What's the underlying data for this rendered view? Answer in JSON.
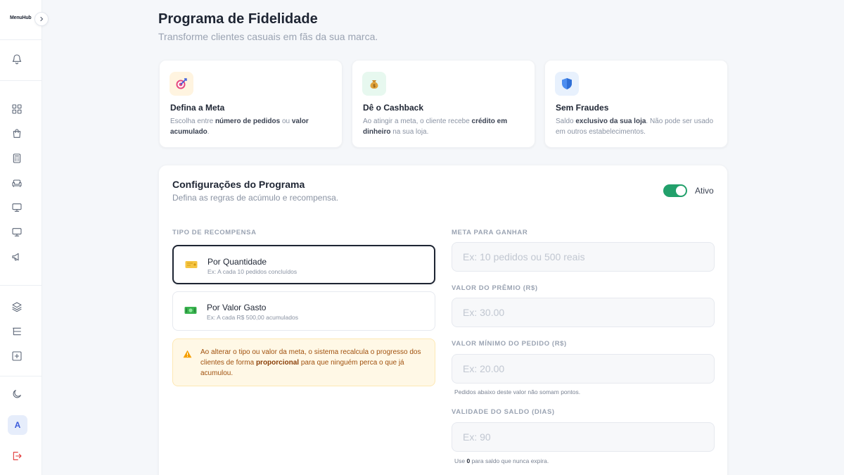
{
  "sidebar": {
    "brand": "MenuHub",
    "avatar_initial": "A",
    "icons": [
      "bell-icon",
      "dashboard-icon",
      "shopping-bag-icon",
      "calculator-icon",
      "sofa-icon",
      "monitor-icon",
      "monitor-icon",
      "megaphone-icon",
      "layers-icon",
      "list-tree-icon",
      "plus-square-icon",
      "moon-icon",
      "logout-icon"
    ],
    "colors": {
      "logout": "#e03131",
      "avatar_bg": "#e6edfb"
    }
  },
  "header": {
    "title": "Programa de Fidelidade",
    "subtitle": "Transforme clientes casuais em fãs da sua marca."
  },
  "features": [
    {
      "icon": "target-icon",
      "title": "Defina a Meta",
      "desc_parts": [
        "Escolha entre ",
        "número de pedidos",
        " ou ",
        "valor acumulado",
        "."
      ]
    },
    {
      "icon": "money-bag-icon",
      "title": "Dê o Cashback",
      "desc_parts": [
        "Ao atingir a meta, o cliente recebe ",
        "crédito em dinheiro",
        " na sua loja."
      ]
    },
    {
      "icon": "shield-icon",
      "title": "Sem Fraudes",
      "desc_parts": [
        "Saldo ",
        "exclusivo da sua loja",
        ". Não pode ser usado em outros estabelecimentos."
      ]
    }
  ],
  "config": {
    "title": "Configurações do Programa",
    "subtitle": "Defina as regras de acúmulo e recompensa.",
    "toggle_label": "Ativo",
    "toggle_on": true,
    "accent": "#22a06b",
    "reward_type_label": "Tipo de Recompensa",
    "reward_options": [
      {
        "title": "Por Quantidade",
        "subtitle": "Ex: A cada 10 pedidos concluídos",
        "selected": true
      },
      {
        "title": "Por Valor Gasto",
        "subtitle": "Ex: A cada R$ 500,00 acumulados",
        "selected": false
      }
    ],
    "alert": {
      "parts": [
        "Ao alterar o tipo ou valor da meta, o sistema recalcula o progresso dos clientes de forma ",
        "proporcional",
        " para que ninguém perca o que já acumulou."
      ]
    },
    "fields": [
      {
        "label": "Meta para Ganhar",
        "placeholder": "Ex: 10 pedidos ou 500 reais",
        "value": ""
      },
      {
        "label": "Valor do Prêmio (R$)",
        "placeholder": "Ex: 30.00",
        "value": ""
      },
      {
        "label": "Valor Mínimo do Pedido (R$)",
        "placeholder": "Ex: 20.00",
        "value": "",
        "hint": "Pedidos abaixo deste valor não somam pontos."
      },
      {
        "label": "Validade do Saldo (Dias)",
        "placeholder": "Ex: 90",
        "value": "",
        "hint_parts": [
          "Use ",
          "0",
          " para saldo que nunca expira."
        ]
      }
    ]
  }
}
